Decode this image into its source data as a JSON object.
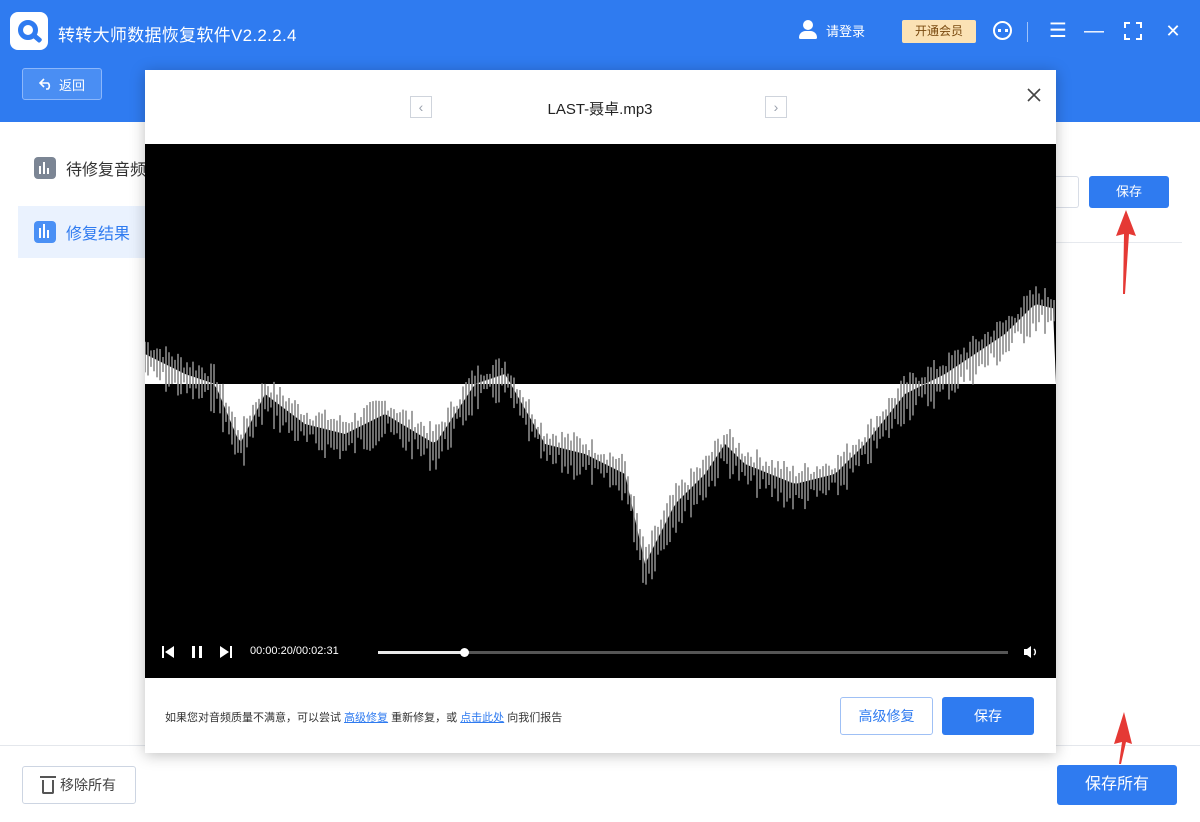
{
  "app": {
    "title": "转转大师数据恢复软件V2.2.2.4",
    "login_label": "请登录",
    "vip_label": "开通会员",
    "menu_icon": "☰",
    "minimize_icon": "—",
    "maximize_icon": "⛶",
    "close_icon": "✕"
  },
  "toolbar": {
    "back_label": "返回"
  },
  "sidebar": {
    "items": [
      {
        "label": "待修复音频",
        "icon": "audio-file-icon"
      },
      {
        "label": "修复结果",
        "icon": "audio-result-icon"
      }
    ]
  },
  "background": {
    "save_label": "保存"
  },
  "footer": {
    "remove_all_label": "移除所有",
    "save_all_label": "保存所有"
  },
  "modal": {
    "title": "LAST-聂卓.mp3",
    "prev_icon": "‹",
    "next_icon": "›",
    "close_icon": "✕",
    "player": {
      "current_time": "00:00:20",
      "total_time": "00:02:31",
      "time_display": "00:00:20/00:02:31",
      "progress_fraction": 0.1366
    },
    "hint": {
      "part1": "如果您对音频质量不满意，可以尝试",
      "link1": "高级修复",
      "part2": "重新修复，或",
      "link2": "点击此处",
      "part3": "向我们报告"
    },
    "advanced_repair_label": "高级修复",
    "save_label": "保存"
  },
  "colors": {
    "brand": "#2f7bf0",
    "vip_bg": "#fbe2b5",
    "arrow": "#e53935"
  }
}
